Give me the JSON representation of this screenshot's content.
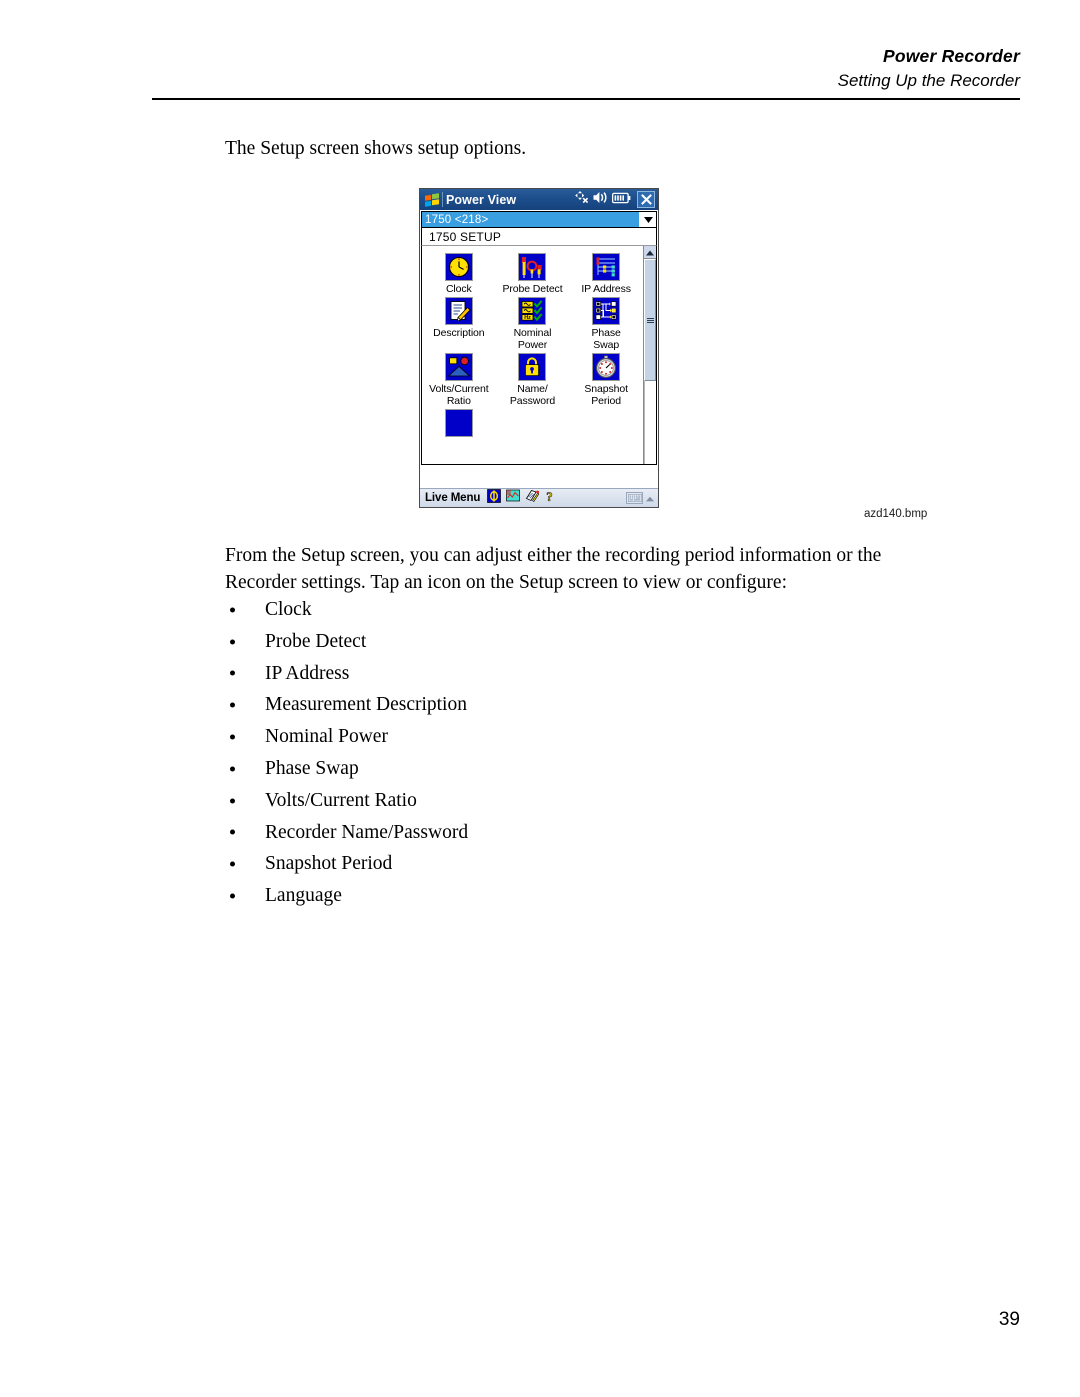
{
  "header": {
    "title": "Power Recorder",
    "subtitle": "Setting Up the Recorder"
  },
  "intro_line": "The Setup screen shows setup options.",
  "paragraph": "From the Setup screen, you can adjust either the recording period information or the Recorder settings. Tap an icon on the Setup screen to view or configure:",
  "bullets": [
    {
      "label": "Clock"
    },
    {
      "label": "Probe Detect"
    },
    {
      "label": "IP Address"
    },
    {
      "label": "Measurement Description"
    },
    {
      "label": "Nominal Power"
    },
    {
      "label": "Phase Swap"
    },
    {
      "label": "Volts/Current Ratio"
    },
    {
      "label": "Recorder Name/Password"
    },
    {
      "label": "Snapshot Period"
    },
    {
      "label": "Language"
    }
  ],
  "figure": {
    "caption": "azd140.bmp",
    "pda": {
      "titlebar": {
        "app_title": "Power View",
        "logo_icon": "windows-flag-icon",
        "tray_icons": [
          "connectivity-disconnected-icon",
          "volume-speaker-icon",
          "battery-icon"
        ],
        "close_label": "✕"
      },
      "combo": {
        "value": "1750 <218>",
        "arrow_icon": "chevron-down-icon"
      },
      "screen_label": "1750 SETUP",
      "icons": [
        {
          "label": "Clock",
          "icon": "clock-icon"
        },
        {
          "label": "Probe Detect",
          "icon": "probe-detect-icon"
        },
        {
          "label": "IP Address",
          "icon": "ip-address-icon"
        },
        {
          "label": "Description",
          "icon": "description-icon"
        },
        {
          "label": "Nominal\nPower",
          "icon": "nominal-power-icon"
        },
        {
          "label": "Phase\nSwap",
          "icon": "phase-swap-icon"
        },
        {
          "label": "Volts/Current\nRatio",
          "icon": "volts-current-ratio-icon"
        },
        {
          "label": "Name/\nPassword",
          "icon": "name-password-icon"
        },
        {
          "label": "Snapshot\nPeriod",
          "icon": "snapshot-period-icon"
        }
      ],
      "scrollbar": {
        "up_arrow_icon": "caret-up-icon"
      },
      "taskbar": {
        "label": "Live Menu",
        "icons": [
          "phi-meter-icon",
          "chart-monitor-icon",
          "notes-pencil-icon",
          "help-question-icon"
        ],
        "sip_icon": "keyboard-icon",
        "sip_arrow_icon": "caret-up-icon"
      }
    }
  },
  "page_number": "39",
  "colors": {
    "icon_blue": "#0000c8",
    "title_blue": "#1d4e8c",
    "combo_highlight": "#3a9fe0",
    "taskbar": "#cfd9e8"
  }
}
